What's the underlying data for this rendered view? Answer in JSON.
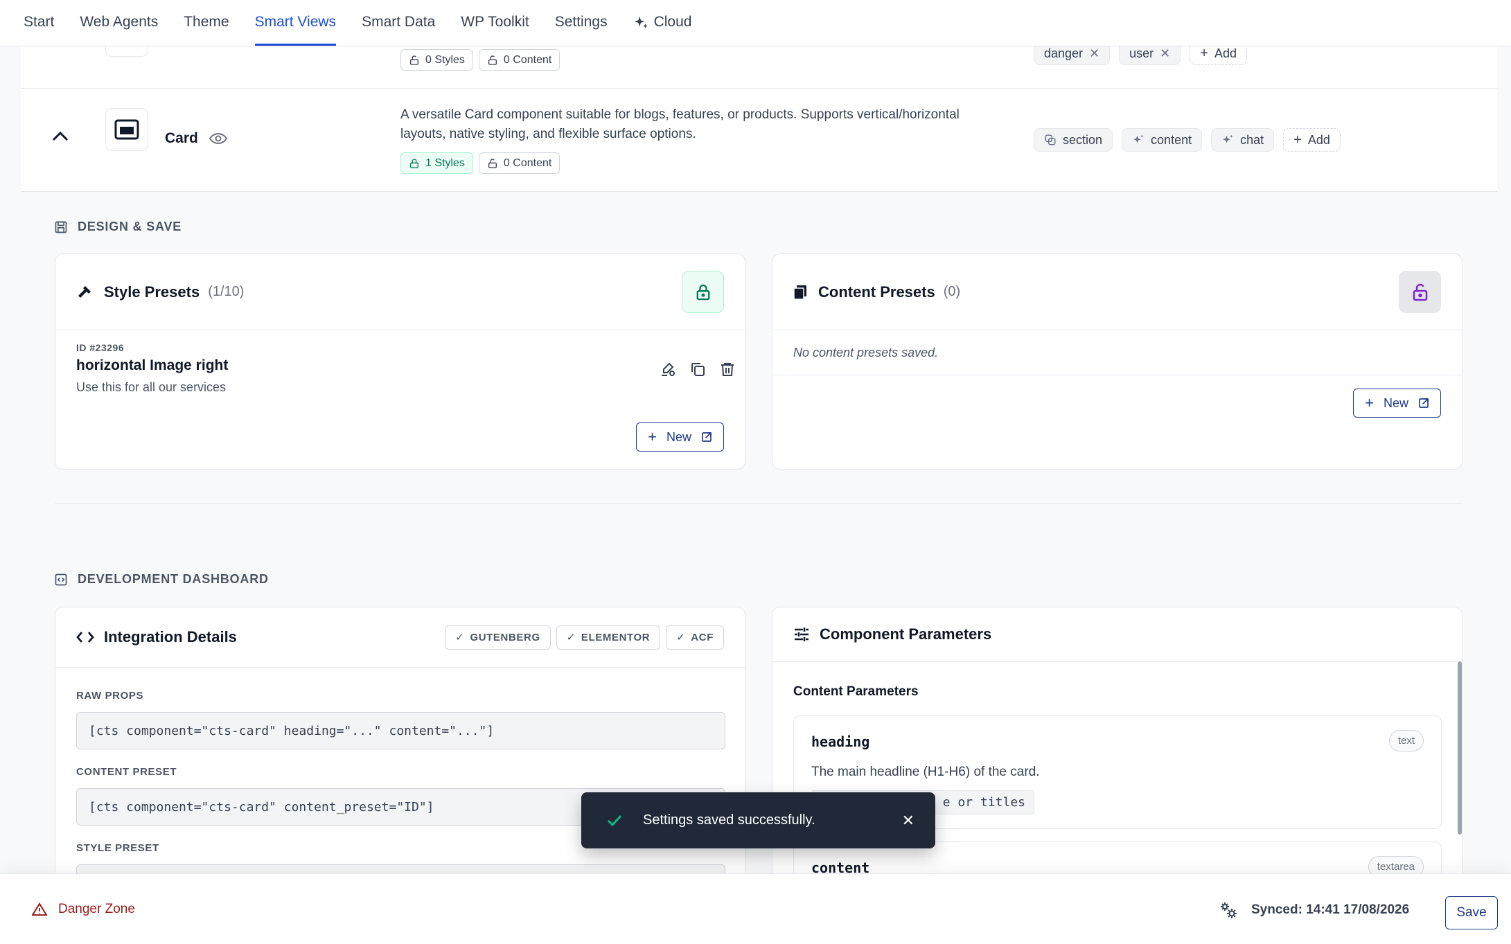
{
  "nav": {
    "tabs": [
      {
        "label": "Start"
      },
      {
        "label": "Web Agents"
      },
      {
        "label": "Theme"
      },
      {
        "label": "Smart Views",
        "active": true
      },
      {
        "label": "Smart Data"
      },
      {
        "label": "WP Toolkit"
      },
      {
        "label": "Settings"
      },
      {
        "label": "Cloud",
        "icon": "sparkle-icon"
      }
    ]
  },
  "prev_row": {
    "styles_pill": "0 Styles",
    "content_pill": "0 Content",
    "tags": [
      "danger",
      "user"
    ],
    "add_label": "Add"
  },
  "card_row": {
    "name": "Card",
    "description_line1": "A versatile Card component suitable for blogs, features, or products. Supports vertical/horizontal",
    "description_line2": "layouts, native styling, and flexible surface options.",
    "styles_pill": "1 Styles",
    "content_pill": "0 Content",
    "tags": [
      "section",
      "content",
      "chat"
    ],
    "add_label": "Add"
  },
  "design": {
    "section_title": "DESIGN & SAVE",
    "style_presets": {
      "title": "Style Presets",
      "count": "(1/10)",
      "item": {
        "id": "ID #23296",
        "name": "horizontal Image right",
        "description": "Use this for all our services"
      },
      "new_label": "New"
    },
    "content_presets": {
      "title": "Content Presets",
      "count": "(0)",
      "empty": "No content presets saved.",
      "new_label": "New"
    }
  },
  "dev": {
    "section_title": "DEVELOPMENT DASHBOARD",
    "integration": {
      "title": "Integration Details",
      "badges": [
        "GUTENBERG",
        "ELEMENTOR",
        "ACF"
      ],
      "raw_props_label": "RAW PROPS",
      "raw_props_code": "[cts component=\"cts-card\" heading=\"...\" content=\"...\"]",
      "content_preset_label": "CONTENT PRESET",
      "content_preset_code": "[cts component=\"cts-card\" content_preset=\"ID\"]",
      "style_preset_label": "STYLE PRESET"
    },
    "params": {
      "title": "Component Parameters",
      "subtitle": "Content Parameters",
      "items": [
        {
          "name": "heading",
          "type": "text",
          "description": "The main headline (H1-H6) of the card.",
          "hint": "e or titles"
        },
        {
          "name": "content",
          "type": "textarea"
        }
      ]
    }
  },
  "toast": {
    "message": "Settings saved successfully."
  },
  "footer": {
    "danger_label": "Danger Zone",
    "synced_label": "Synced: 14:41 17/08/2026",
    "save_label": "Save"
  },
  "colors": {
    "accent": "#1d4ed8",
    "danger": "#991b1b",
    "success": "#10b981",
    "toast_bg": "#1f2937"
  }
}
